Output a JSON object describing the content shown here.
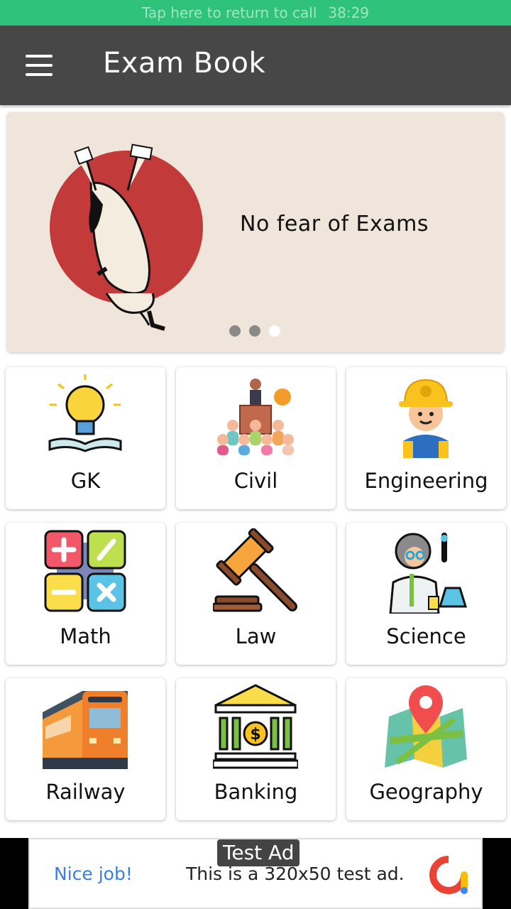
{
  "status_bar": {
    "call_text": "Tap here to return to call",
    "call_timer": "38:29"
  },
  "app_bar": {
    "title": "Exam Book",
    "menu_icon": "hamburger-menu-icon"
  },
  "banner": {
    "text": "No fear of Exams",
    "slide_count": 3,
    "active_slide": 3
  },
  "categories": [
    {
      "label": "GK",
      "icon": "lightbulb-book-icon"
    },
    {
      "label": "Civil",
      "icon": "podium-crowd-icon"
    },
    {
      "label": "Engineering",
      "icon": "engineer-hardhat-icon"
    },
    {
      "label": "Math",
      "icon": "calculator-symbols-icon"
    },
    {
      "label": "Law",
      "icon": "gavel-icon"
    },
    {
      "label": "Science",
      "icon": "scientist-icon"
    },
    {
      "label": "Railway",
      "icon": "train-icon"
    },
    {
      "label": "Banking",
      "icon": "bank-icon"
    },
    {
      "label": "Geography",
      "icon": "map-pin-icon"
    }
  ],
  "ad": {
    "badge": "Test Ad",
    "headline": "Nice job!",
    "body": "This is a 320x50 test ad.",
    "icon": "ad-logo-icon"
  },
  "colors": {
    "status_bar": "#2fc27a",
    "app_bar": "#474747",
    "banner_bg": "#f0e5da",
    "banner_circle": "#c23a3a",
    "ad_headline": "#3b7fe0"
  }
}
